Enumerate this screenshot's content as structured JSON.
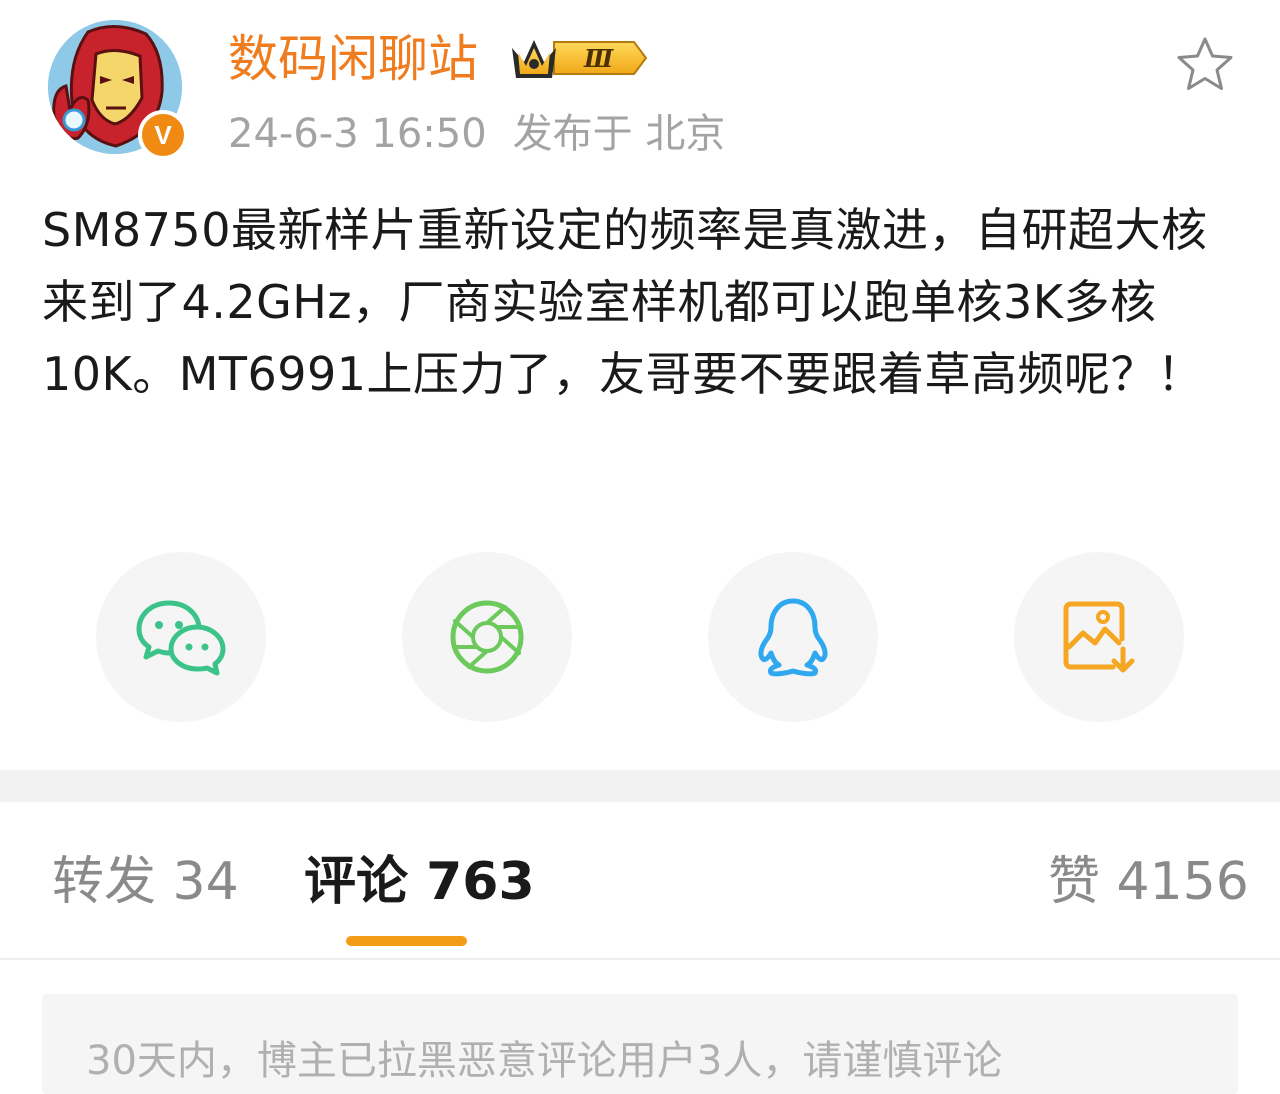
{
  "post": {
    "author": {
      "name": "数码闲聊站",
      "level_badge": "Ⅲ",
      "verified_mark": "V"
    },
    "timestamp": "24-6-3 16:50",
    "location": "发布于 北京",
    "text": "SM8750最新样片重新设定的频率是真激进，自研超大核来到了4.2GHz，厂商实验室样机都可以跑单核3K多核10K。MT6991上压力了，友哥要不要跟着草高频呢？！",
    "favorite_icon": "star-outline-icon"
  },
  "share": [
    {
      "name": "wechat",
      "icon": "wechat-icon",
      "color": "#3cc38a"
    },
    {
      "name": "moments",
      "icon": "camera-shutter-icon",
      "color": "#6cc95c"
    },
    {
      "name": "qq",
      "icon": "qq-penguin-icon",
      "color": "#2fa8f0"
    },
    {
      "name": "save-image",
      "icon": "save-image-icon",
      "color": "#f5a623"
    }
  ],
  "tabs": {
    "repost": "转发 34",
    "comment": "评论 763",
    "like": "赞 4156",
    "accent": "#f39c17"
  },
  "notice": {
    "text": "30天内，博主已拉黑恶意评论用户3人，请谨慎评论"
  }
}
